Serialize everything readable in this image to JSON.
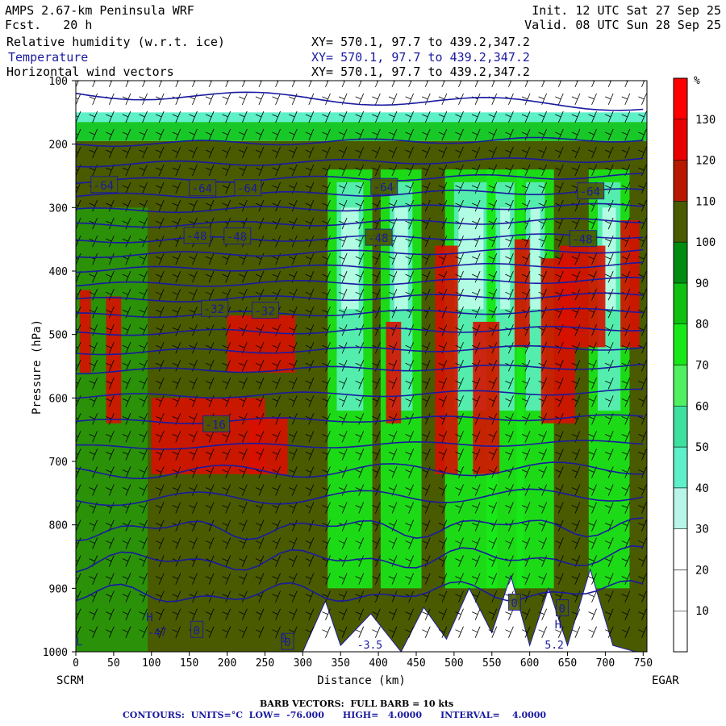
{
  "header": {
    "title": "AMPS 2.67-km Peninsula WRF",
    "fcst_label": "Fcst.",
    "fcst_value": "20 h",
    "init": "Init. 12 UTC Sat 27 Sep 25",
    "valid": "Valid. 08 UTC Sun 28 Sep 25",
    "fields": [
      {
        "name": "Relative humidity (w.r.t. ice)",
        "xy": "XY= 570.1, 97.7 to 439.2,347.2",
        "color": "#000000"
      },
      {
        "name": "Temperature",
        "xy": "XY= 570.1, 97.7 to 439.2,347.2",
        "color": "#1a1aa0"
      },
      {
        "name": "Horizontal wind vectors",
        "xy": "XY= 570.1, 97.7 to 439.2,347.2",
        "color": "#000000"
      }
    ]
  },
  "chart_data": {
    "type": "heatmap",
    "title": "AMPS 2.67-km Peninsula WRF",
    "xlabel": "Distance (km)",
    "ylabel": "Pressure (hPa)",
    "xlim": [
      0,
      755
    ],
    "ylim": [
      1000,
      100
    ],
    "x_ticks": [
      0,
      50,
      100,
      150,
      200,
      250,
      300,
      350,
      400,
      450,
      500,
      550,
      600,
      650,
      700,
      750
    ],
    "y_ticks": [
      100,
      200,
      300,
      400,
      500,
      600,
      700,
      800,
      900,
      1000
    ],
    "endpoints": {
      "left": "SCRM",
      "right": "EGAR"
    },
    "colorbar": {
      "unit": "%",
      "levels": [
        10,
        20,
        30,
        40,
        50,
        60,
        70,
        80,
        90,
        100,
        110,
        120,
        130
      ],
      "colors": [
        "#ffffff",
        "#ffffff",
        "#ffffff",
        "#b8f5e8",
        "#5ef0c8",
        "#3ee0a0",
        "#50f060",
        "#18e818",
        "#10c010",
        "#008c10",
        "#4a5a00",
        "#b81800",
        "#e80000",
        "#ff0000"
      ]
    },
    "temperature_contours": {
      "units": "°C",
      "low": -76.0,
      "high": 4.0,
      "interval": 4.0,
      "labels": [
        {
          "value": "-64",
          "x": 20,
          "p": 265
        },
        {
          "value": "-64",
          "x": 150,
          "p": 270
        },
        {
          "value": "-64",
          "x": 210,
          "p": 270
        },
        {
          "value": "-64",
          "x": 390,
          "p": 268
        },
        {
          "value": "-64",
          "x": 663,
          "p": 275
        },
        {
          "value": "-48",
          "x": 143,
          "p": 345
        },
        {
          "value": "-48",
          "x": 196,
          "p": 346
        },
        {
          "value": "-48",
          "x": 383,
          "p": 348
        },
        {
          "value": "-48",
          "x": 653,
          "p": 350
        },
        {
          "value": "-32",
          "x": 166,
          "p": 460
        },
        {
          "value": "-32",
          "x": 233,
          "p": 463
        },
        {
          "value": "-16",
          "x": 168,
          "p": 642
        },
        {
          "value": "0",
          "x": 152,
          "p": 966
        },
        {
          "value": "0",
          "x": 572,
          "p": 923
        },
        {
          "value": "0",
          "x": 635,
          "p": 932
        },
        {
          "value": "0",
          "x": 272,
          "p": 985
        }
      ],
      "levels_p": [
        200,
        232,
        258,
        282,
        305,
        328,
        352,
        375,
        398,
        422,
        446,
        470,
        498,
        528,
        558,
        598,
        638,
        678,
        718,
        760,
        808,
        858,
        912
      ]
    },
    "extrema": [
      {
        "type": "H",
        "x": 93,
        "p": 952
      },
      {
        "type": "H",
        "x": 633,
        "p": 963
      },
      {
        "type": "L",
        "x": 0,
        "p": 990
      }
    ],
    "misc_labels": [
      "-47",
      "0",
      "-3.5",
      "5.2"
    ]
  },
  "footer": {
    "barb": "BARB VECTORS:  FULL BARB = 10 kts",
    "contours_label": "CONTOURS:",
    "units": "UNITS=°C",
    "low": "LOW=  -76.000",
    "high": "HIGH=   4.0000",
    "interval": "INTERVAL=    4.0000"
  }
}
